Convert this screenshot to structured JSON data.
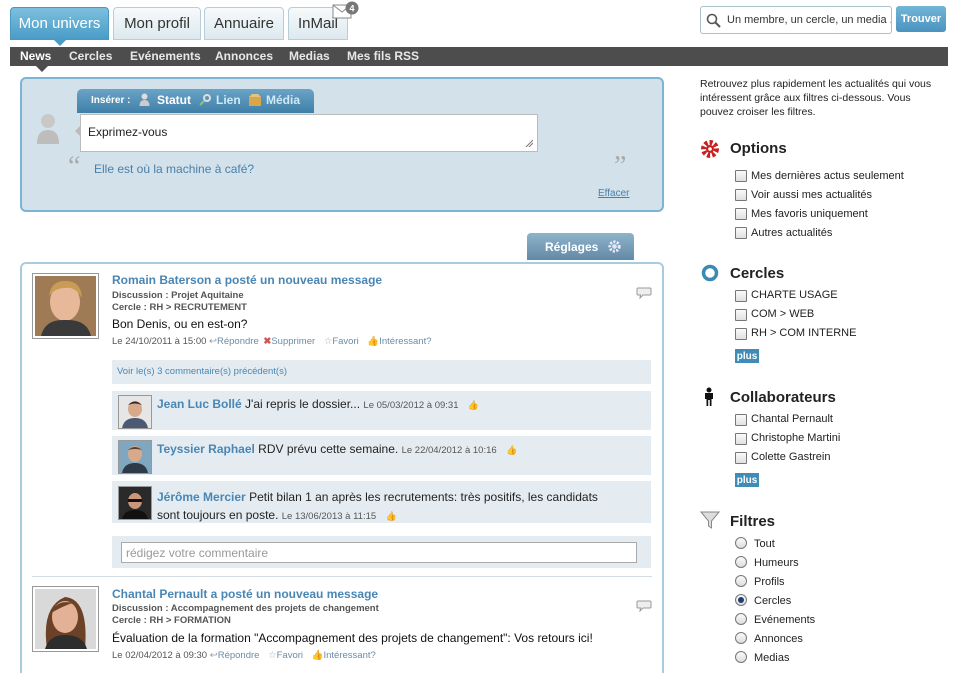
{
  "tabs": [
    {
      "label": "Mon univers",
      "active": true
    },
    {
      "label": "Mon profil"
    },
    {
      "label": "Annuaire"
    },
    {
      "label": "InMail",
      "badge": "4"
    }
  ],
  "search": {
    "placeholder": "Un membre, un cercle, un media ...",
    "button": "Trouver"
  },
  "subnav": [
    "News",
    "Cercles",
    "Evénements",
    "Annonces",
    "Medias",
    "Mes fils RSS"
  ],
  "composer": {
    "insert_label": "Insérer :",
    "statut": "Statut",
    "lien": "Lien",
    "media": "Média",
    "input_value": "Exprimez-vous",
    "quote": "Elle est où la machine à café?",
    "clear": "Effacer"
  },
  "settings_button": "Réglages",
  "posts": [
    {
      "title": "Romain Baterson a posté un nouveau message",
      "discussion": "Discussion : Projet Aquitaine",
      "cercle": "Cercle : RH > RECRUTEMENT",
      "body": "Bon Denis, ou en est-on?",
      "date": "Le 24/10/2011 à 15:00",
      "reply": "Répondre",
      "delete": "Supprimer",
      "fav": "Favori",
      "interest": "Intéressant?",
      "previous": "Voir le(s) 3 commentaire(s) précédent(s)",
      "comments": [
        {
          "name": "Jean Luc Bollé",
          "text": "J'ai repris le dossier...",
          "date": "Le 05/03/2012 à 09:31"
        },
        {
          "name": "Teyssier Raphael",
          "text": "RDV prévu cette semaine.",
          "date": "Le 22/04/2012 à 10:16"
        },
        {
          "name": "Jérôme Mercier",
          "text": "Petit bilan 1 an après les recrutements: très positifs, les candidats",
          "text2": "sont toujours en poste.",
          "date": "Le 13/06/2013 à 11:15"
        }
      ],
      "comment_placeholder": "rédigez votre commentaire"
    },
    {
      "title": "Chantal Pernault a posté un nouveau message",
      "discussion": "Discussion : Accompagnement des projets de changement",
      "cercle": "Cercle : RH > FORMATION",
      "body": "Évaluation de la formation \"Accompagnement des projets de changement\": Vos retours ici!",
      "date": "Le 02/04/2012 à 09:30",
      "reply": "Répondre",
      "fav": "Favori",
      "interest": "Intéressant?"
    }
  ],
  "sidebar": {
    "intro": [
      "Retrouvez plus rapidement les actualités qui vous",
      "intéressent grâce aux filtres ci-dessous. Vous",
      "pouvez croiser les filtres."
    ],
    "options": {
      "title": "Options",
      "items": [
        "Mes dernières actus seulement",
        "Voir aussi mes actualités",
        "Mes favoris uniquement",
        "Autres actualités"
      ]
    },
    "cercles": {
      "title": "Cercles",
      "items": [
        "CHARTE USAGE",
        "COM > WEB",
        "RH > COM INTERNE"
      ],
      "plus": "plus"
    },
    "collaborateurs": {
      "title": "Collaborateurs",
      "items": [
        "Chantal Pernault",
        "Christophe Martini",
        "Colette Gastrein"
      ],
      "plus": "plus"
    },
    "filtres": {
      "title": "Filtres",
      "items": [
        "Tout",
        "Humeurs",
        "Profils",
        "Cercles",
        "Evénements",
        "Annonces",
        "Medias"
      ],
      "selected": "Cercles"
    }
  }
}
